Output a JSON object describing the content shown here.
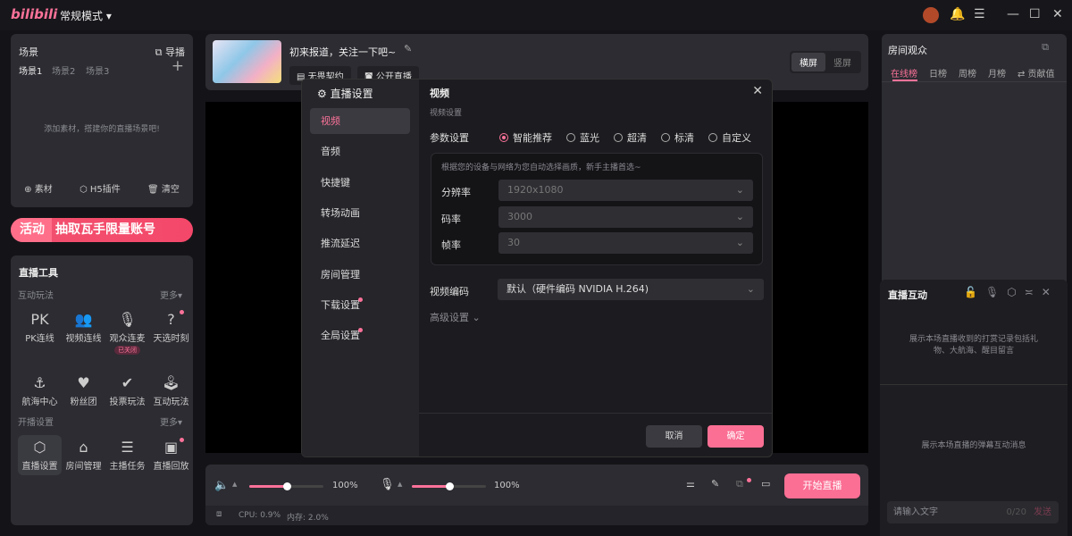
{
  "app": {
    "logo": "bilibili",
    "mode": "常规模式 ▾",
    "window_icons": [
      "avatar",
      "bell-icon",
      "menu-icon",
      "minimize-icon",
      "maximize-icon",
      "close-icon"
    ]
  },
  "colors": {
    "accent": "#fb7299",
    "panel": "#2c2c32",
    "background": "#141418"
  },
  "scene": {
    "title": "场景",
    "director": "导播",
    "tabs": [
      "场景1",
      "场景2",
      "场景3"
    ],
    "add": "+",
    "placeholder": "添加素材，搭建你的直播场景吧!",
    "actions": [
      "素材",
      "H5插件",
      "清空"
    ]
  },
  "banner": {
    "tag": "活动",
    "text": "抽取瓦手限量账号"
  },
  "tools": {
    "title": "直播工具",
    "section1": "互动玩法",
    "more1": "更多▾",
    "items1": [
      {
        "label": "PK连线",
        "glyph": "PK"
      },
      {
        "label": "视频连线",
        "glyph": "👥"
      },
      {
        "label": "观众连麦",
        "glyph": "🎙",
        "badge": "已关闭"
      },
      {
        "label": "天选时刻",
        "glyph": "?",
        "dot": true
      },
      {
        "label": "航海中心",
        "glyph": "⚓"
      },
      {
        "label": "粉丝团",
        "glyph": "♥"
      },
      {
        "label": "投票玩法",
        "glyph": "✔"
      },
      {
        "label": "互动玩法",
        "glyph": "🕹"
      }
    ],
    "section2": "开播设置",
    "more2": "更多▾",
    "items2": [
      {
        "label": "直播设置",
        "glyph": "⬡"
      },
      {
        "label": "房间管理",
        "glyph": "⌂"
      },
      {
        "label": "主播任务",
        "glyph": "☰"
      },
      {
        "label": "直播回放",
        "glyph": "▣",
        "dot": true
      }
    ]
  },
  "room": {
    "title": "初来报道，关注一下吧~",
    "tags": [
      "无畏契约",
      "公开直播"
    ],
    "orientation": [
      "横屏",
      "竖屏"
    ]
  },
  "controls": {
    "speaker_volume": "100%",
    "mic_volume": "100%",
    "speaker_level": 0.5,
    "mic_level": 0.5,
    "start": "开始直播",
    "cpu": "CPU: 0.9%",
    "memory": "内存: 2.0%"
  },
  "audience": {
    "title": "房间观众",
    "tabs": [
      "在线榜",
      "日榜",
      "周榜",
      "月榜",
      "⇄ 贡献值"
    ]
  },
  "interaction": {
    "title": "直播互动",
    "gift_hint": "展示本场直播收到的打赏记录包括礼物、大航海、醒目留言",
    "danmaku_hint": "展示本场直播的弹幕互动消息",
    "input_placeholder": "请输入文字",
    "count": "0/20",
    "send": "发送"
  },
  "modal": {
    "title": "直播设置",
    "nav": [
      "视频",
      "音频",
      "快捷键",
      "转场动画",
      "推流延迟",
      "房间管理",
      "下载设置",
      "全局设置"
    ],
    "nav_dots": [
      6,
      7
    ],
    "section": "视频",
    "subtitle": "视频设置",
    "param_label": "参数设置",
    "presets": [
      "智能推荐",
      "蓝光",
      "超清",
      "标清",
      "自定义"
    ],
    "selected_preset": "智能推荐",
    "hint": "根据您的设备与网络为您自动选择画质，新手主播首选~",
    "fields": [
      {
        "label": "分辨率",
        "value": "1920x1080"
      },
      {
        "label": "码率",
        "value": "3000"
      },
      {
        "label": "帧率",
        "value": "30"
      }
    ],
    "encoder_label": "视频编码",
    "encoder_value": "默认（硬件编码 NVIDIA H.264)",
    "advanced": "高级设置 ⌄",
    "cancel": "取消",
    "ok": "确定"
  }
}
